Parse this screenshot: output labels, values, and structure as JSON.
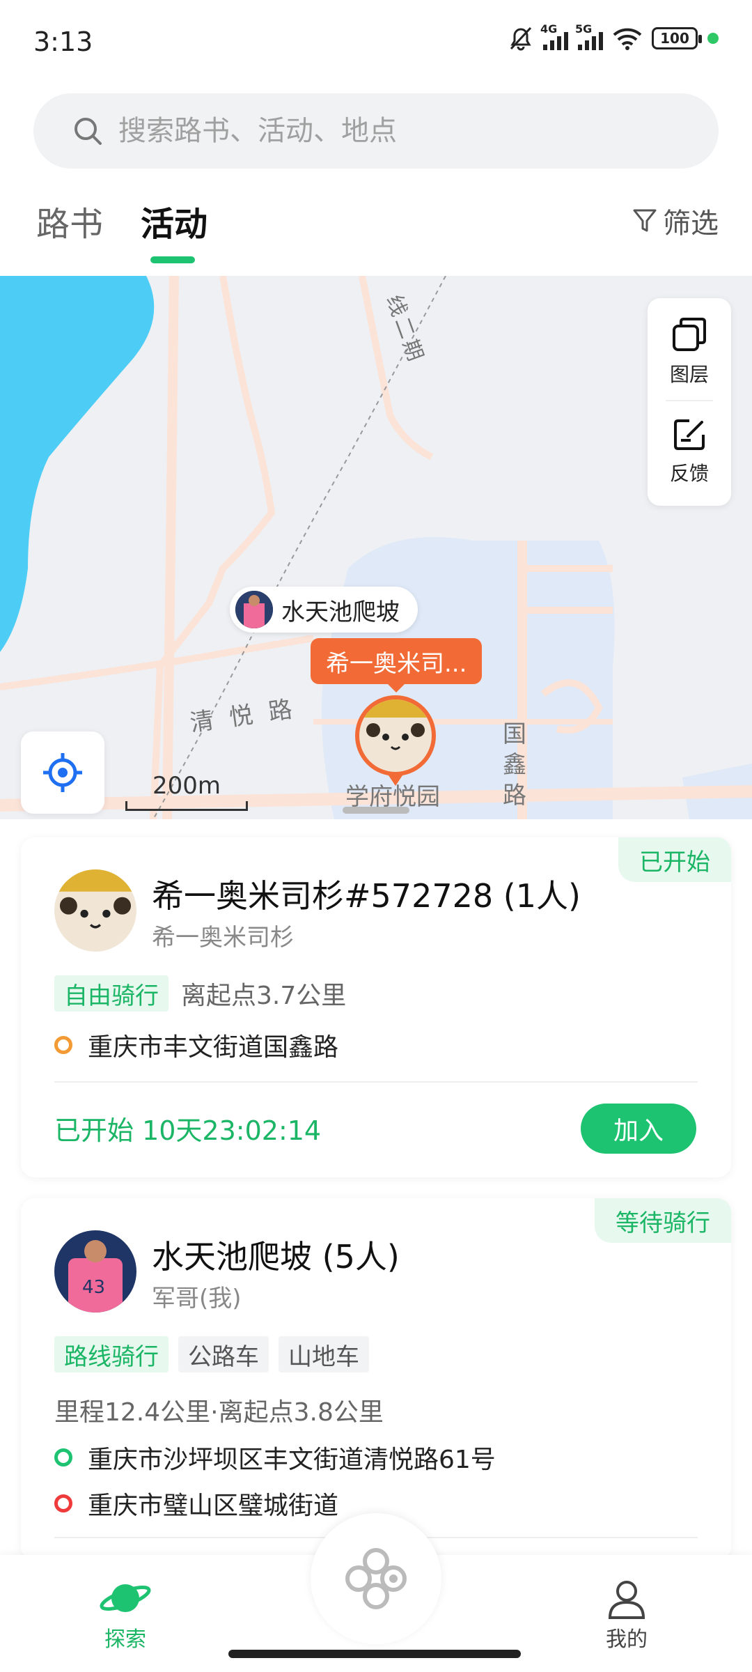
{
  "status_bar": {
    "time": "3:13",
    "net1": "4G",
    "net2": "5G",
    "battery": "100"
  },
  "search": {
    "placeholder": "搜索路书、活动、地点"
  },
  "tabs": [
    {
      "label": "路书"
    },
    {
      "label": "活动"
    }
  ],
  "filter_label": "筛选",
  "map": {
    "tools": {
      "layers_label": "图层",
      "feedback_label": "反馈"
    },
    "scale": "200m",
    "pill_label": "水天池爬坡",
    "active_marker_label": "希一奥米司...",
    "place_label": "学府悦园",
    "road_labels": [
      "清 悦 路",
      "国\n鑫\n路",
      "线二期"
    ]
  },
  "cards": [
    {
      "status": "已开始",
      "title": "希一奥米司杉#572728 (1人)",
      "subtitle": "希一奥米司杉",
      "chips": [
        "自由骑行"
      ],
      "distance": "离起点3.7公里",
      "address": "重庆市丰文街道国鑫路",
      "started_text": "已开始 10天23:02:14",
      "join_label": "加入"
    },
    {
      "status": "等待骑行",
      "title": "水天池爬坡 (5人)",
      "subtitle": "军哥(我)",
      "chips": [
        "路线骑行",
        "公路车",
        "山地车"
      ],
      "meta": "里程12.4公里·离起点3.8公里",
      "start_address": "重庆市沙坪坝区丰文街道清悦路61号",
      "end_address": "重庆市璧山区璧城街道"
    }
  ],
  "bottom_nav": {
    "explore_label": "探索",
    "mine_label": "我的"
  },
  "colors": {
    "accent": "#1ec372",
    "orange": "#f26b36",
    "water": "#4dcdf5"
  }
}
